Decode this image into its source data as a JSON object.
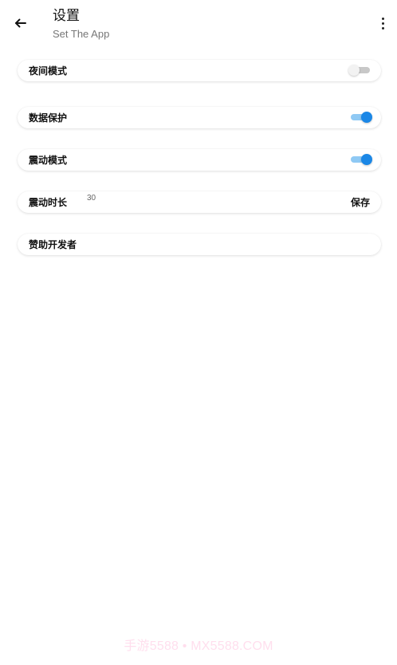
{
  "colors": {
    "accent": "#1b87e6",
    "switch_on_track": "#8fc9f4",
    "switch_off_track": "#c8c8c8",
    "watermark": "#ff78b7"
  },
  "header": {
    "title": "设置",
    "subtitle": "Set The App",
    "back_icon": "arrow-left-icon",
    "more_icon": "more-vert-icon"
  },
  "settings": {
    "night_mode": {
      "label": "夜间模式",
      "enabled": false
    },
    "data_protection": {
      "label": "数据保护",
      "enabled": true
    },
    "vibration_mode": {
      "label": "震动模式",
      "enabled": true
    },
    "vibration_duration": {
      "label": "震动时长",
      "value": "30",
      "action_label": "保存"
    },
    "sponsor": {
      "label": "赞助开发者"
    }
  },
  "watermark": "手游5588 • MX5588.COM"
}
